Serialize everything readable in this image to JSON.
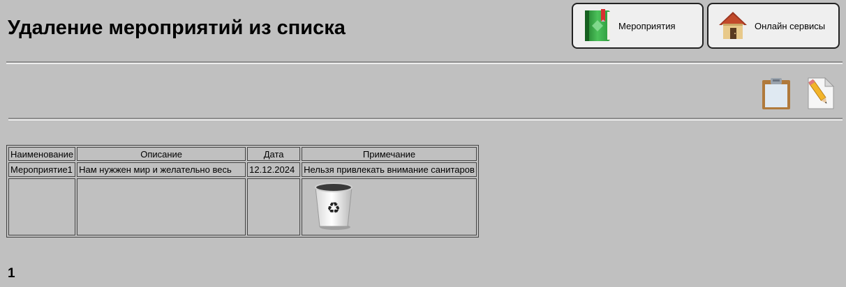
{
  "page": {
    "title": "Удаление мероприятий из списка",
    "background": "#c0c0c0"
  },
  "nav": {
    "events_label": "Мероприятия",
    "online_label": "Онлайн сервисы"
  },
  "toolbar": {
    "clipboard_icon": "clipboard-icon",
    "edit_icon": "edit-document-icon"
  },
  "table": {
    "columns": [
      "Наименование",
      "Описание",
      "Дата",
      "Примечание"
    ],
    "rows": [
      [
        "Мероприятие1",
        "Нам нужжен мир и желательно весь",
        "12.12.2024",
        "Нельзя привлекать внимание санитаров"
      ]
    ],
    "delete_icon": "recycle-bin-icon"
  },
  "pagination": {
    "current_page": "1"
  }
}
